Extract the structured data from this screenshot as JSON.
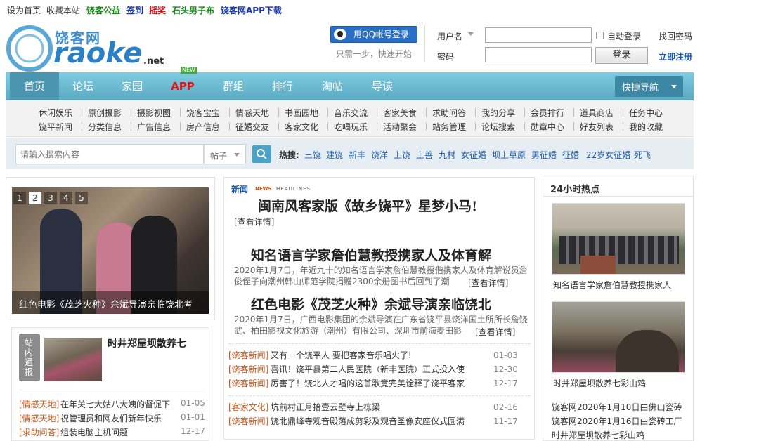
{
  "topbar": {
    "set_home": "设为首页",
    "bookmark": "收藏本站",
    "charity": "饶客公益",
    "signin": "签到",
    "lottery": "摇奖",
    "stone": "石头男子布",
    "app_download": "饶客网APP下载"
  },
  "logo": {
    "brand_cn": "饶客网",
    "brand_en": "raoke",
    "suffix": ".net"
  },
  "login": {
    "qq_button": "用QQ帐号登录",
    "qq_tip": "只需一步，快速开始",
    "username_label": "用户名",
    "password_label": "密码",
    "remember": "自动登录",
    "find_password": "找回密码",
    "login_button": "登录",
    "register": "立即注册"
  },
  "nav": {
    "items": [
      "首页",
      "论坛",
      "家园",
      "APP",
      "群组",
      "排行",
      "淘帖",
      "导读"
    ],
    "new_badge": "NEW",
    "quick_nav": "快捷导航"
  },
  "subnav": {
    "row1": [
      "休闲娱乐",
      "原创摄影",
      "摄影视图",
      "饶客宝宝",
      "情感天地",
      "书画园地",
      "音乐交流",
      "客家美食",
      "求助问答",
      "我的分享",
      "会员排行",
      "道具商店",
      "任务中心"
    ],
    "row2": [
      "饶平新闻",
      "分类信息",
      "广告信息",
      "房产信息",
      "征婚交友",
      "客家文化",
      "吃喝玩乐",
      "活动聚会",
      "站务管理",
      "论坛搜索",
      "勋章中心",
      "好友列表",
      "我的收藏"
    ]
  },
  "search": {
    "placeholder": "请输入搜索内容",
    "scope": "帖子",
    "hot_label": "热搜:",
    "hot": [
      "三饶",
      "建饶",
      "新丰",
      "饶洋",
      "上饶",
      "上善",
      "九村",
      "女征婚",
      "坝上草原",
      "男征婚",
      "征婚",
      "22岁女征婚",
      "死飞"
    ]
  },
  "slider": {
    "pages": [
      "1",
      "2",
      "3",
      "4",
      "5"
    ],
    "caption": "红色电影《茂芝火种》余斌导演亲临饶北考"
  },
  "station_news": {
    "tag": "站内通报",
    "title": "时井郑屋坝散养七",
    "items": [
      {
        "cat": "[情感天地]",
        "title": "在年关七大姑八大姨的督促下",
        "date": "01-05"
      },
      {
        "cat": "[情感天地]",
        "title": "祝管理员和网友们新年快乐",
        "date": "01-01"
      },
      {
        "cat": "[求助问答]",
        "title": "组装电脑主机问题",
        "date": "12-17"
      }
    ]
  },
  "news": {
    "label_cn": "新闻",
    "label_en": "NEWS",
    "label_headlines": "HEADLINES",
    "top_title": "闽南风客家版《故乡饶平》星梦小马!",
    "top_more": "[查看详情]",
    "articles": [
      {
        "title": "知名语言学家詹伯慧教授携家人及体育解",
        "desc": "2020年1月7日，年近九十的知名语言学家詹伯慧教授偕携家人及体育解说员詹俊侄子向潮州韩山师范学院捐赠2300余册图书后回到了潮",
        "more": "[查看详情]"
      },
      {
        "title": "红色电影《茂芝火种》余斌导演亲临饶北",
        "desc": "2020年1月7日，广西电影集团的余斌导演在广东省饶平县饶洋国土所所长詹饶武、柏田影视文化旅游（潮州）有限公司、深圳市前海麦田影",
        "more": "[查看详情]"
      }
    ],
    "list1": [
      {
        "cat": "[饶客新闻]",
        "title": "又有一个饶平人 要把客家音乐唱火了!",
        "date": "01-03"
      },
      {
        "cat": "[饶客新闻]",
        "title": "喜讯！饶平县第二人民医院（新丰医院）正式投入使",
        "date": "12-30"
      },
      {
        "cat": "[饶客新闻]",
        "title": "厉害了！饶北人才唱的这首歌竟完美诠释了饶平客家",
        "date": "12-17"
      }
    ],
    "list2": [
      {
        "cat": "[客家文化]",
        "title": "坑前村正月拾壹云壁寺上栋梁",
        "date": "02-16"
      },
      {
        "cat": "[饶客新闻]",
        "title": "饶北鼎峰寺观音殿落成剪彩及观音圣像安座仪式圆满",
        "date": "11-17"
      }
    ]
  },
  "hot24": {
    "title": "24小时热点",
    "photo1_caption": "知名语言学家詹伯慧教授携家人",
    "photo2_caption": "时井郑屋坝散养七彩山鸡",
    "links": [
      "饶客网2020年1月10日由佛山瓷砖",
      "饶客网2020年1月16日由瓷砖工厂",
      "时井郑屋坝散养七彩山鸡"
    ]
  },
  "colors": {
    "nav": "#6dbbd1",
    "accent_orange": "#c85a1e",
    "link_blue": "#1c5aa8",
    "green": "#1b8a1b",
    "red": "#d8131a"
  }
}
